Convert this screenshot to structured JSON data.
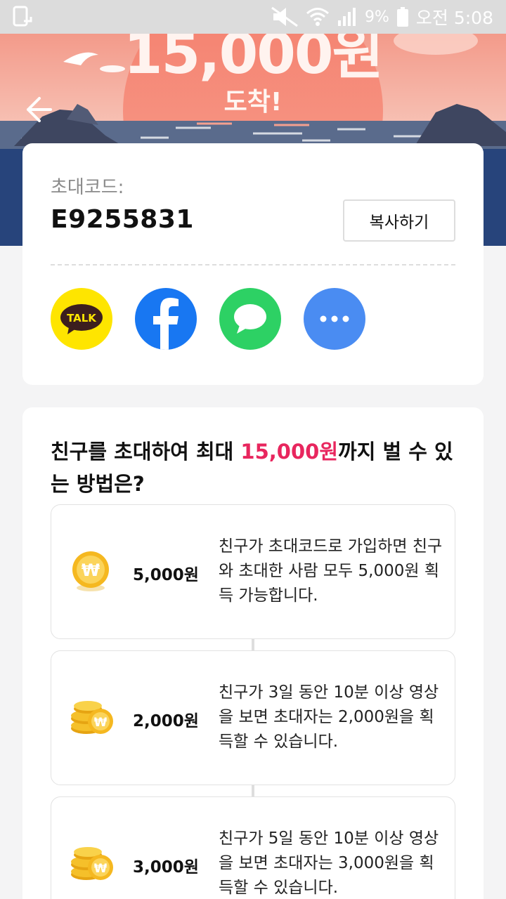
{
  "status_bar": {
    "battery_percent": "9%",
    "time": "오전 5:08"
  },
  "hero": {
    "amount": "15,000원",
    "subtitle": "도착!"
  },
  "invite": {
    "code_label": "초대코드:",
    "code_value": "E9255831",
    "copy_label": "복사하기",
    "kakao_label": "TALK"
  },
  "info": {
    "title_pre": "친구를 초대하여 최대 ",
    "title_highlight": "15,000원",
    "title_post": "까지 벌 수 있는 방법은?",
    "highlight_color": "#e8265e",
    "rewards": [
      {
        "amount": "5,000원",
        "desc": "친구가 초대코드로 가입하면 친구와 초대한 사람 모두 5,000원 획득 가능합니다.",
        "icon": "single-coin-icon"
      },
      {
        "amount": "2,000원",
        "desc": "친구가 3일 동안 10분 이상 영상을 보면 초대자는 2,000원을 획득할 수 있습니다.",
        "icon": "coin-stack-icon"
      },
      {
        "amount": "3,000원",
        "desc": "친구가 5일 동안 10분 이상 영상을 보면 초대자는 3,000원을 획득할 수 있습니다.",
        "icon": "coin-stack-icon"
      }
    ]
  }
}
